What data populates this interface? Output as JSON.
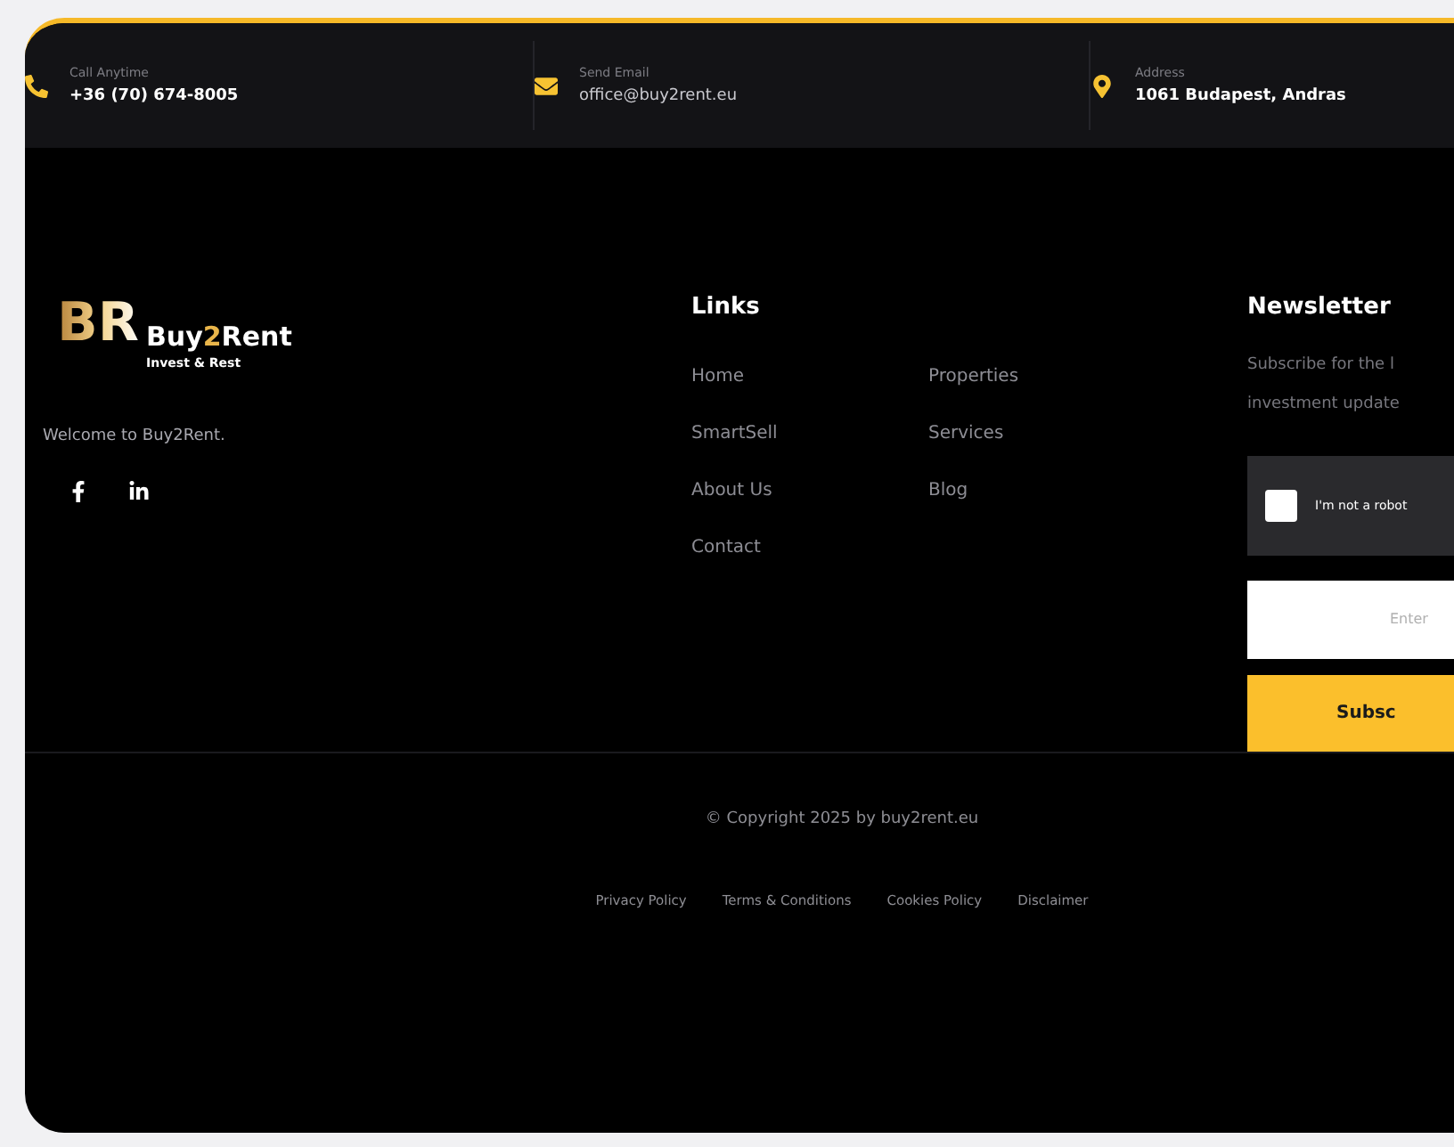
{
  "contacts": [
    {
      "kind": "phone",
      "label": "Call Anytime",
      "value": "+36 (70) 674-8005"
    },
    {
      "kind": "email",
      "label": "Send Email",
      "value": "office@buy2rent.eu"
    },
    {
      "kind": "address",
      "label": "Address",
      "value": "1061 Budapest, Andras"
    }
  ],
  "brand": {
    "monogram": "BR",
    "name_start": "Buy",
    "name_accent": "2",
    "name_end": "Rent",
    "tagline": "Invest & Rest",
    "welcome": "Welcome to Buy2Rent."
  },
  "socials": [
    {
      "kind": "facebook"
    },
    {
      "kind": "linkedin"
    }
  ],
  "links": {
    "title": "Links",
    "items": [
      "Home",
      "Properties",
      "SmartSell",
      "Services",
      "About Us",
      "Blog",
      "Contact"
    ]
  },
  "newsletter": {
    "title": "Newsletter",
    "text_lines": [
      "Subscribe for the l",
      "investment update"
    ],
    "captcha": {
      "label": "I'm not a robot",
      "checked": false
    },
    "email": {
      "placeholder": "Enter"
    },
    "button": "Subsc"
  },
  "copyright": "© Copyright 2025 by buy2rent.eu",
  "legal_links": [
    "Privacy Policy",
    "Terms & Conditions",
    "Cookies Policy",
    "Disclaimer"
  ]
}
